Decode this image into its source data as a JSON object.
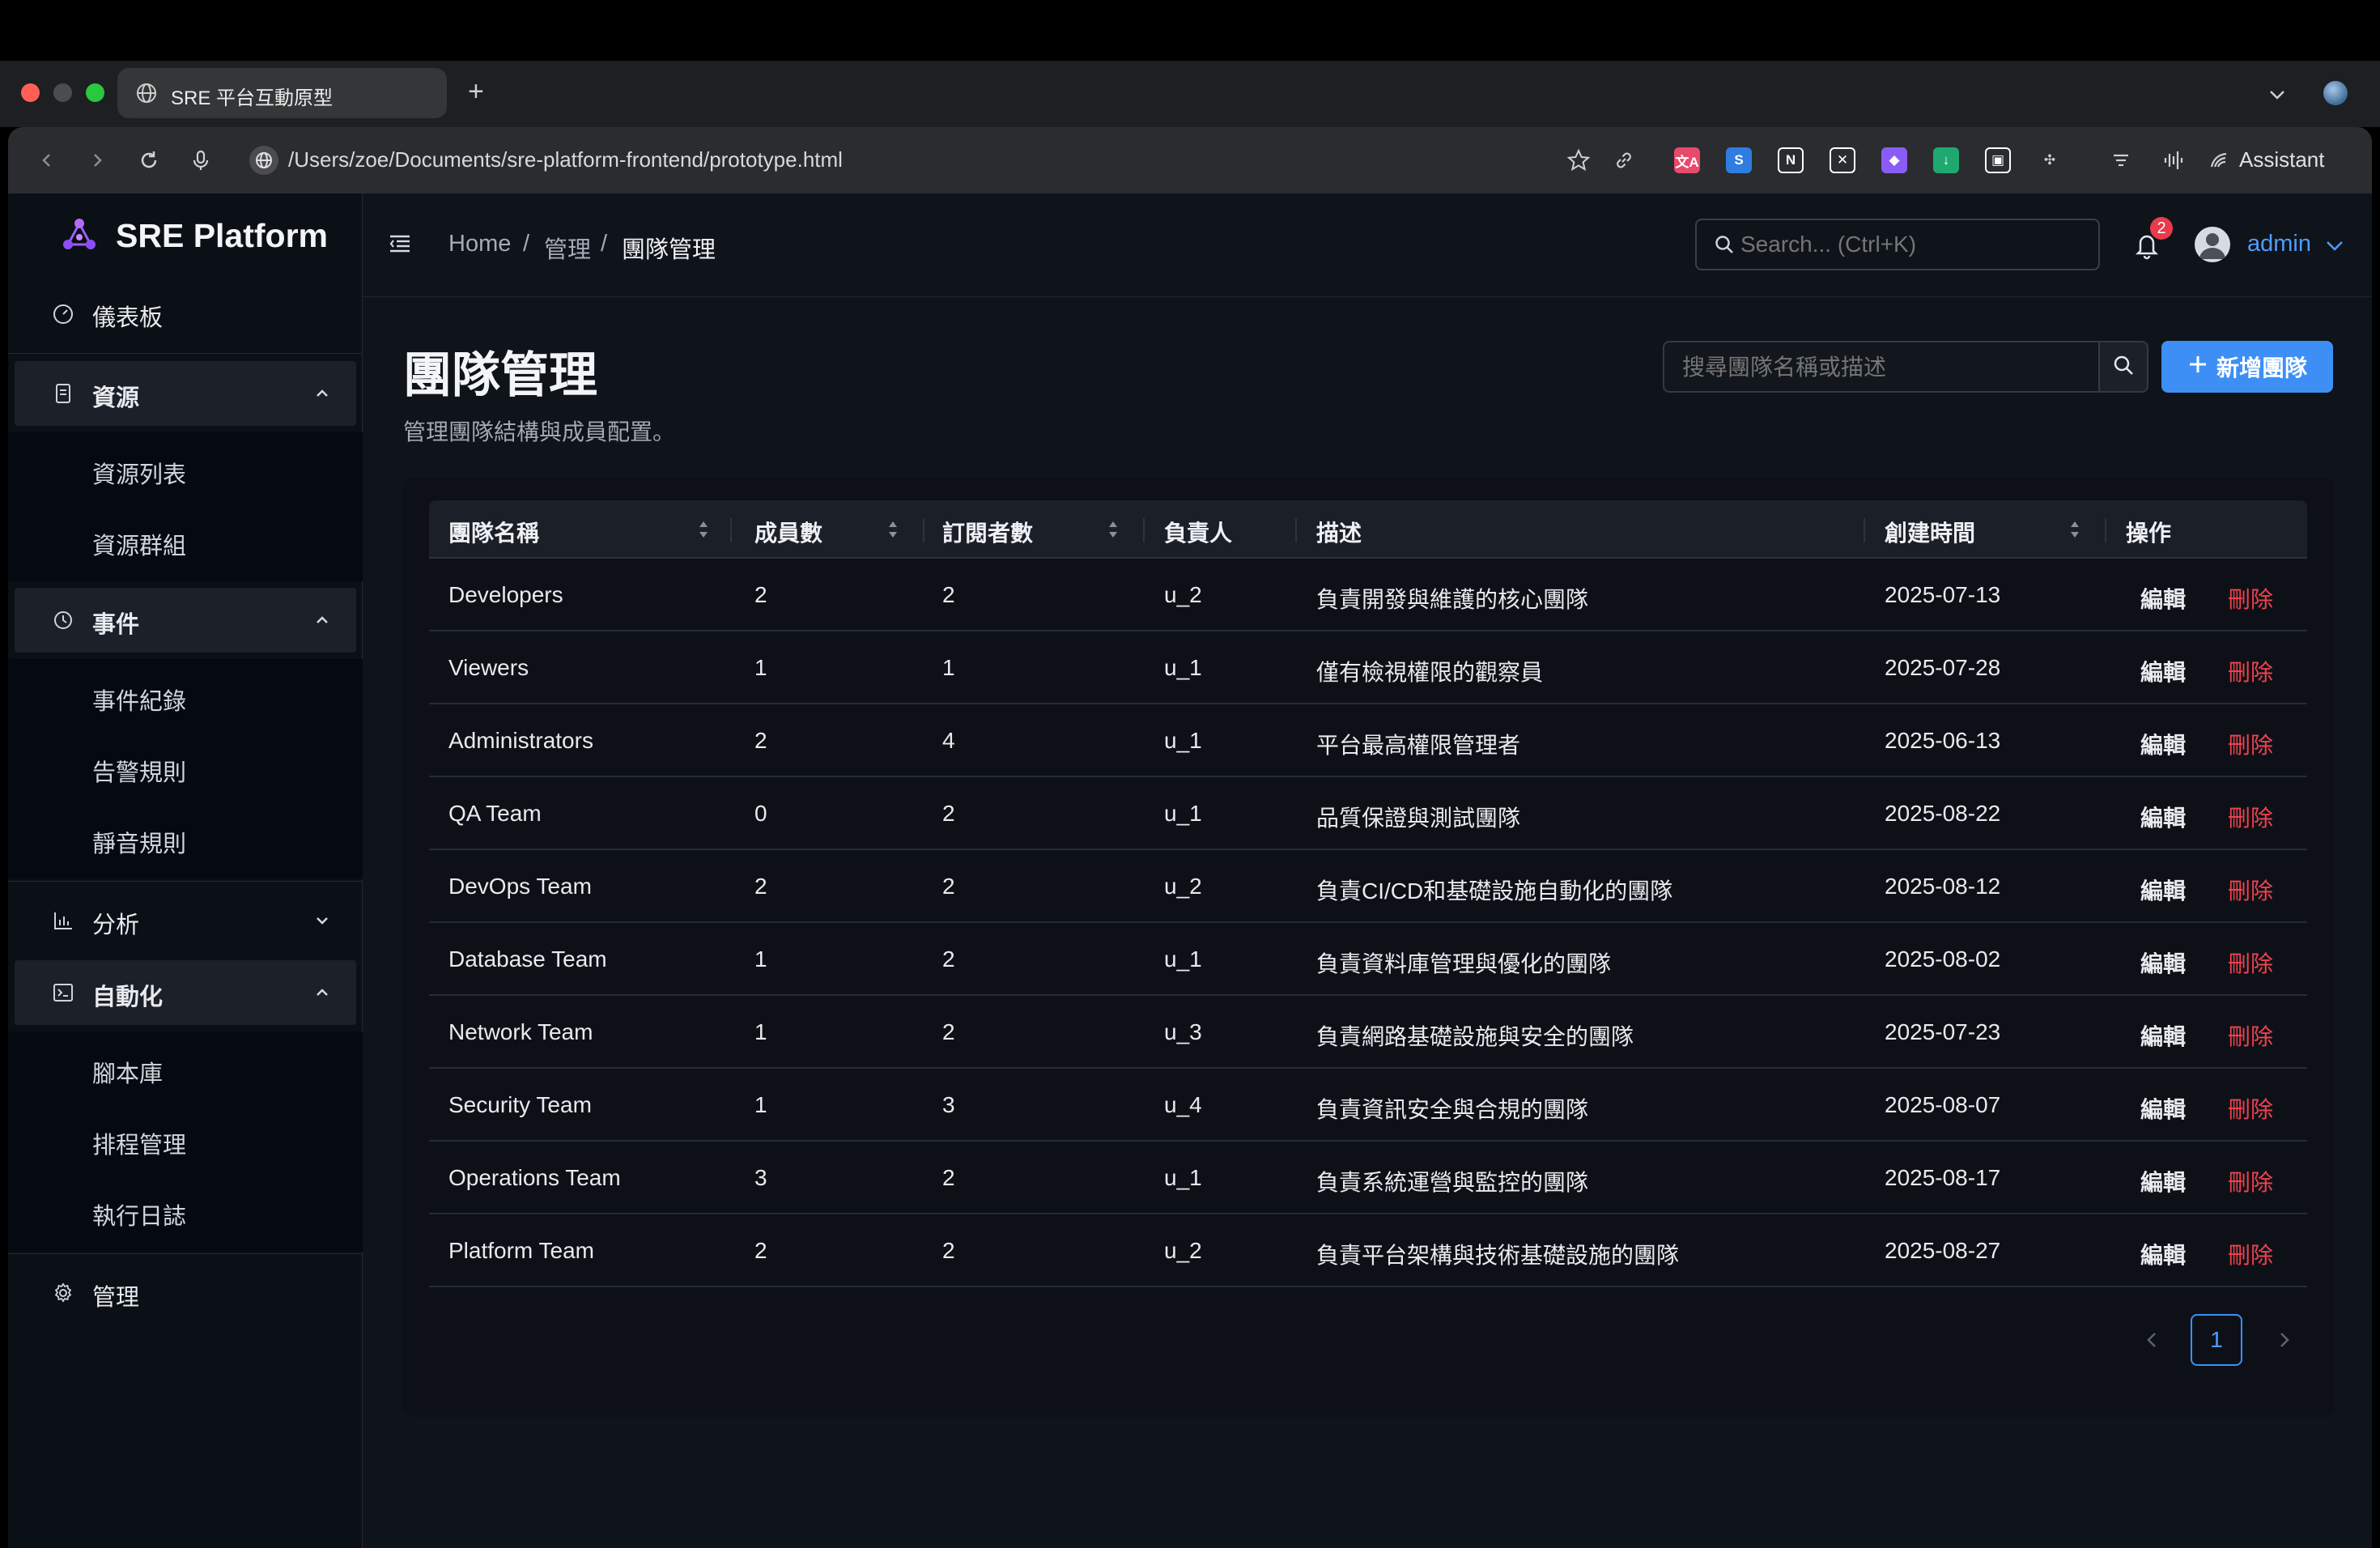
{
  "browser": {
    "tab_title": "SRE 平台互動原型",
    "new_tab": "+",
    "url": "/Users/zoe/Documents/sre-platform-frontend/prototype.html",
    "assistant_label": "Assistant",
    "extensions": [
      {
        "icon": "translate-ext-icon",
        "text": "文A",
        "color": "#e84a6c"
      },
      {
        "icon": "s-ext-icon",
        "text": "S",
        "color": "#2f7de1"
      },
      {
        "icon": "notion-ext-icon",
        "text": "N",
        "color": "#ffffff"
      },
      {
        "icon": "tools-ext-icon",
        "text": "✕",
        "color": "#ffffff"
      },
      {
        "icon": "diamond-ext-icon",
        "text": "◆",
        "color": "#8a5cf6"
      },
      {
        "icon": "download-ext-icon",
        "text": "↓",
        "color": "#1fa971"
      },
      {
        "icon": "save-ext-icon",
        "text": "▣",
        "color": "#ffffff"
      },
      {
        "icon": "puzzle-ext-icon",
        "text": "✣",
        "color": "#cfcfcf"
      }
    ]
  },
  "sidebar": {
    "logo": "SRE Platform",
    "dashboard": "儀表板",
    "resources": {
      "label": "資源",
      "items": [
        "資源列表",
        "資源群組"
      ]
    },
    "events": {
      "label": "事件",
      "items": [
        "事件紀錄",
        "告警規則",
        "靜音規則"
      ]
    },
    "analysis": {
      "label": "分析"
    },
    "automation": {
      "label": "自動化",
      "items": [
        "腳本庫",
        "排程管理",
        "執行日誌"
      ]
    },
    "admin": "管理"
  },
  "header": {
    "breadcrumb": [
      "Home",
      "管理",
      "團隊管理"
    ],
    "breadcrumb_sep": "/",
    "search_placeholder": "Search... (Ctrl+K)",
    "notification_count": "2",
    "user": "admin"
  },
  "page": {
    "title": "團隊管理",
    "subtitle": "管理團隊結構與成員配置。",
    "search_placeholder": "搜尋團隊名稱或描述",
    "add_button": "新增團隊"
  },
  "table": {
    "columns": [
      "團隊名稱",
      "成員數",
      "訂閱者數",
      "負責人",
      "描述",
      "創建時間",
      "操作"
    ],
    "edit_label": "編輯",
    "delete_label": "刪除",
    "rows": [
      {
        "name": "Developers",
        "members": "2",
        "subscribers": "2",
        "owner": "u_2",
        "desc": "負責開發與維護的核心團隊",
        "created": "2025-07-13"
      },
      {
        "name": "Viewers",
        "members": "1",
        "subscribers": "1",
        "owner": "u_1",
        "desc": "僅有檢視權限的觀察員",
        "created": "2025-07-28"
      },
      {
        "name": "Administrators",
        "members": "2",
        "subscribers": "4",
        "owner": "u_1",
        "desc": "平台最高權限管理者",
        "created": "2025-06-13"
      },
      {
        "name": "QA Team",
        "members": "0",
        "subscribers": "2",
        "owner": "u_1",
        "desc": "品質保證與測試團隊",
        "created": "2025-08-22"
      },
      {
        "name": "DevOps Team",
        "members": "2",
        "subscribers": "2",
        "owner": "u_2",
        "desc": "負責CI/CD和基礎設施自動化的團隊",
        "created": "2025-08-12"
      },
      {
        "name": "Database Team",
        "members": "1",
        "subscribers": "2",
        "owner": "u_1",
        "desc": "負責資料庫管理與優化的團隊",
        "created": "2025-08-02"
      },
      {
        "name": "Network Team",
        "members": "1",
        "subscribers": "2",
        "owner": "u_3",
        "desc": "負責網路基礎設施與安全的團隊",
        "created": "2025-07-23"
      },
      {
        "name": "Security Team",
        "members": "1",
        "subscribers": "3",
        "owner": "u_4",
        "desc": "負責資訊安全與合規的團隊",
        "created": "2025-08-07"
      },
      {
        "name": "Operations Team",
        "members": "3",
        "subscribers": "2",
        "owner": "u_1",
        "desc": "負責系統運營與監控的團隊",
        "created": "2025-08-17"
      },
      {
        "name": "Platform Team",
        "members": "2",
        "subscribers": "2",
        "owner": "u_2",
        "desc": "負責平台架構與技術基礎設施的團隊",
        "created": "2025-08-27"
      }
    ]
  },
  "pagination": {
    "current": "1"
  },
  "colors": {
    "accent": "#3d8ff5",
    "danger": "#f0414f",
    "badge": "#e83b4b"
  }
}
